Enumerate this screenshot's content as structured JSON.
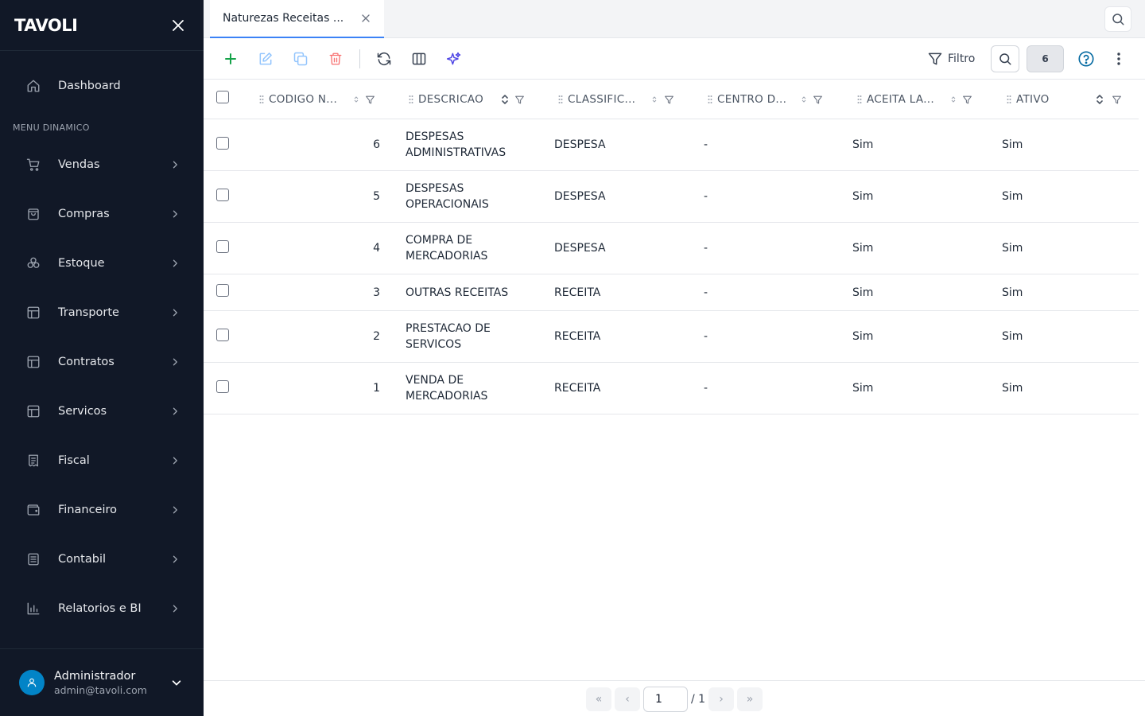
{
  "app": {
    "logo": "TAVOLI",
    "colors": {
      "sidebar_bg": "#111827",
      "accent": "#3b82f6",
      "add": "#16a34a",
      "delete": "#ef4444",
      "ai": "#4f46e5",
      "avatar": "#0284c7"
    }
  },
  "sidebar": {
    "dashboard": {
      "label": "Dashboard",
      "icon": "home-icon"
    },
    "section_title": "MENU DINAMICO",
    "items": [
      {
        "label": "Vendas",
        "icon": "cart-icon"
      },
      {
        "label": "Compras",
        "icon": "shopping-bag-icon"
      },
      {
        "label": "Estoque",
        "icon": "boxes-icon"
      },
      {
        "label": "Transporte",
        "icon": "layout-icon"
      },
      {
        "label": "Contratos",
        "icon": "layout-icon"
      },
      {
        "label": "Servicos",
        "icon": "layout-icon"
      },
      {
        "label": "Fiscal",
        "icon": "receipt-icon"
      },
      {
        "label": "Financeiro",
        "icon": "wallet-icon"
      },
      {
        "label": "Contabil",
        "icon": "ledger-icon"
      },
      {
        "label": "Relatorios e BI",
        "icon": "bar-chart-icon"
      }
    ],
    "user": {
      "name": "Administrador",
      "email": "admin@tavoli.com"
    }
  },
  "tabs": [
    {
      "label": "Naturezas Receitas ...",
      "active": true
    }
  ],
  "toolbar": {
    "filter_label": "Filtro",
    "record_count": "6"
  },
  "table": {
    "columns": [
      {
        "key": "codigo",
        "label": "CODIGO N..."
      },
      {
        "key": "descricao",
        "label": "DESCRICAO"
      },
      {
        "key": "classificacao",
        "label": "CLASSIFIC..."
      },
      {
        "key": "centro",
        "label": "CENTRO D..."
      },
      {
        "key": "aceita",
        "label": "ACEITA LA..."
      },
      {
        "key": "ativo",
        "label": "ATIVO"
      }
    ],
    "rows": [
      {
        "codigo": "6",
        "descricao": "DESPESAS ADMINISTRATIVAS",
        "classificacao": "DESPESA",
        "centro": "-",
        "aceita": "Sim",
        "ativo": "Sim"
      },
      {
        "codigo": "5",
        "descricao": "DESPESAS OPERACIONAIS",
        "classificacao": "DESPESA",
        "centro": "-",
        "aceita": "Sim",
        "ativo": "Sim"
      },
      {
        "codigo": "4",
        "descricao": "COMPRA DE MERCADORIAS",
        "classificacao": "DESPESA",
        "centro": "-",
        "aceita": "Sim",
        "ativo": "Sim"
      },
      {
        "codigo": "3",
        "descricao": "OUTRAS RECEITAS",
        "classificacao": "RECEITA",
        "centro": "-",
        "aceita": "Sim",
        "ativo": "Sim"
      },
      {
        "codigo": "2",
        "descricao": "PRESTACAO DE SERVICOS",
        "classificacao": "RECEITA",
        "centro": "-",
        "aceita": "Sim",
        "ativo": "Sim"
      },
      {
        "codigo": "1",
        "descricao": "VENDA DE MERCADORIAS",
        "classificacao": "RECEITA",
        "centro": "-",
        "aceita": "Sim",
        "ativo": "Sim"
      }
    ]
  },
  "pagination": {
    "first": "«",
    "prev": "‹",
    "next": "›",
    "last": "»",
    "current_page": "1",
    "total_label": "/ 1"
  }
}
